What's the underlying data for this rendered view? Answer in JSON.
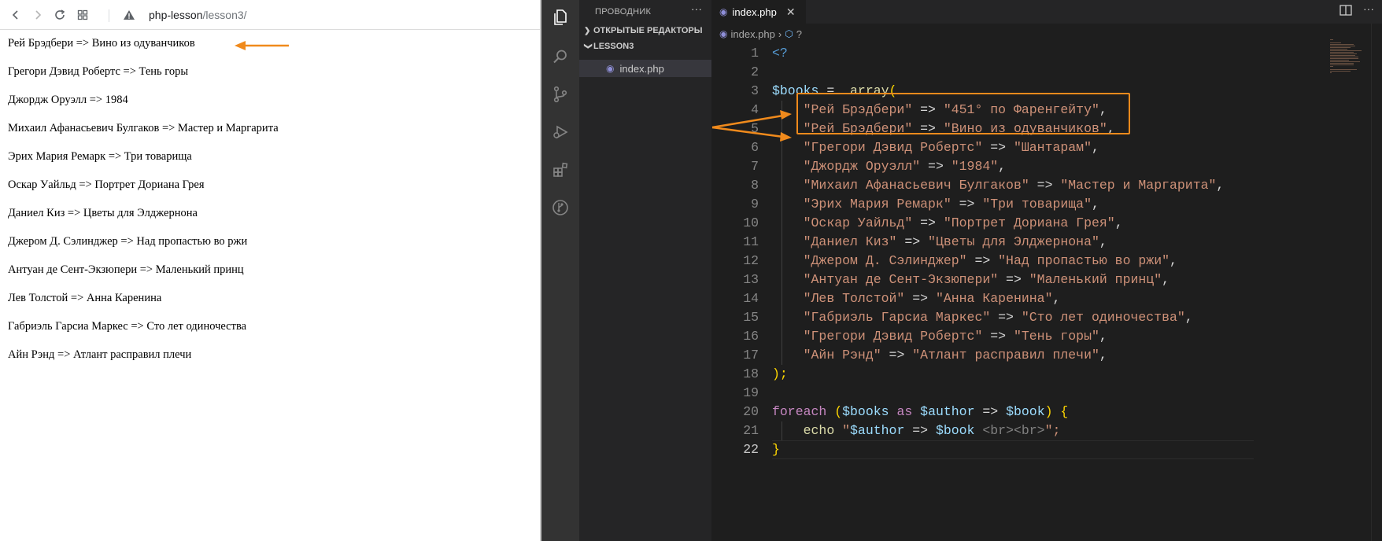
{
  "browser": {
    "url_host": "php-lesson",
    "url_path": "/lesson3/",
    "output_lines": [
      "Рей Брэдбери => Вино из одуванчиков",
      "Грегори Дэвид Робертс => Тень горы",
      "Джордж Оруэлл => 1984",
      "Михаил Афанасьевич Булгаков => Мастер и Маргарита",
      "Эрих Мария Ремарк => Три товарища",
      "Оскар Уайльд => Портрет Дориана Грея",
      "Даниел Киз => Цветы для Элджернона",
      "Джером Д. Сэлинджер => Над пропастью во ржи",
      "Антуан де Сент-Экзюпери => Маленький принц",
      "Лев Толстой => Анна Каренина",
      "Габриэль Гарсиа Маркес => Сто лет одиночества",
      "Айн Рэнд => Атлант расправил плечи"
    ]
  },
  "vscode": {
    "sidebar_title": "ПРОВОДНИК",
    "more_glyph": "···",
    "open_editors_label": "ОТКРЫТЫЕ РЕДАКТОРЫ",
    "folder_label": "LESSON3",
    "file_name": "index.php",
    "tab_label": "index.php",
    "tab_close_glyph": "✕",
    "breadcrumb_file": "index.php",
    "breadcrumb_sep": "›",
    "breadcrumb_symbol": "?"
  },
  "code": {
    "line_numbers": [
      "1",
      "2",
      "3",
      "4",
      "5",
      "6",
      "7",
      "8",
      "9",
      "10",
      "11",
      "12",
      "13",
      "14",
      "15",
      "16",
      "17",
      "18",
      "19",
      "20",
      "21",
      "22"
    ],
    "open_tag": "<?",
    "books_var": "$books",
    "assign": " =  ",
    "array_fn": "array",
    "open_paren": "(",
    "entries": [
      {
        "author": "\"Рей Брэдбери\"",
        "book": "\"451° по Фаренгейту\""
      },
      {
        "author": "\"Рей Брэдбери\"",
        "book": "\"Вино из одуванчиков\""
      },
      {
        "author": "\"Грегори Дэвид Робертс\"",
        "book": "\"Шантарам\""
      },
      {
        "author": "\"Джордж Оруэлл\"",
        "book": "\"1984\""
      },
      {
        "author": "\"Михаил Афанасьевич Булгаков\"",
        "book": "\"Мастер и Маргарита\""
      },
      {
        "author": "\"Эрих Мария Ремарк\"",
        "book": "\"Три товарища\""
      },
      {
        "author": "\"Оскар Уайльд\"",
        "book": "\"Портрет Дориана Грея\""
      },
      {
        "author": "\"Даниел Киз\"",
        "book": "\"Цветы для Элджернона\""
      },
      {
        "author": "\"Джером Д. Сэлинджер\"",
        "book": "\"Над пропастью во ржи\""
      },
      {
        "author": "\"Антуан де Сент-Экзюпери\"",
        "book": "\"Маленький принц\""
      },
      {
        "author": "\"Лев Толстой\"",
        "book": "\"Анна Каренина\""
      },
      {
        "author": "\"Габриэль Гарсиа Маркес\"",
        "book": "\"Сто лет одиночества\""
      },
      {
        "author": "\"Грегори Дэвид Робертс\"",
        "book": "\"Тень горы\""
      },
      {
        "author": "\"Айн Рэнд\"",
        "book": "\"Атлант расправил плечи\""
      }
    ],
    "arrow_op": " => ",
    "comma": ",",
    "close_array": ");",
    "foreach_kw": "foreach",
    "as_kw": "as",
    "author_var": "$author",
    "book_var": "$book",
    "echo_kw": "echo",
    "echo_str_open": "\"",
    "echo_br": " <br><br>",
    "echo_tail": "\";",
    "close_brace": "}",
    "open_brace": "{"
  },
  "annotations": {
    "color": "#f08a1c"
  }
}
